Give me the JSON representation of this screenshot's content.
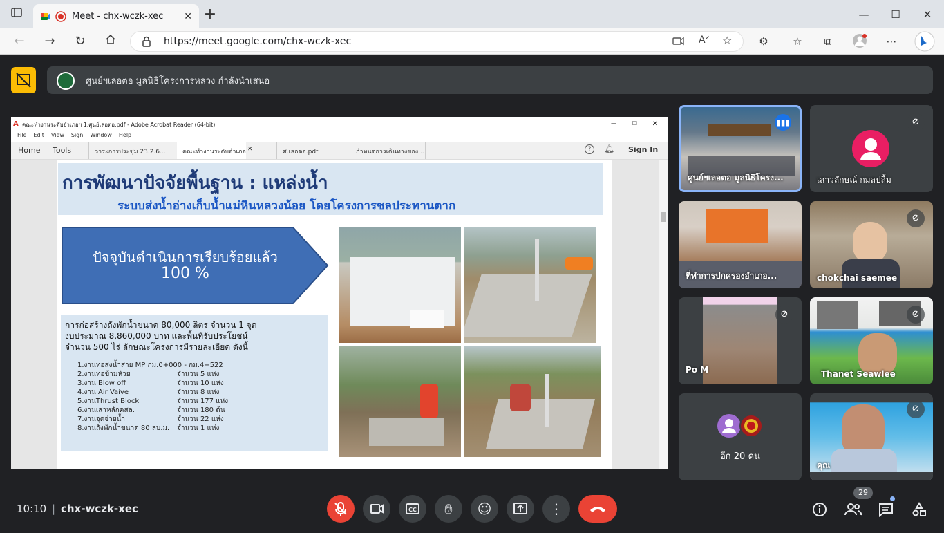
{
  "browser": {
    "tab_title": "Meet - chx-wczk-xec",
    "url": "https://meet.google.com/chx-wczk-xec"
  },
  "banner": {
    "text": "ศูนย์ฯเลอตอ มูลนิธิโครงการหลวง กำลังนำเสนอ"
  },
  "pdf_window": {
    "title": "คณะทำงานระดับอำเภอฯ 1.ศูนย์เลอตอ.pdf - Adobe Acrobat Reader (64-bit)",
    "menu": [
      "File",
      "Edit",
      "View",
      "Sign",
      "Window",
      "Help"
    ],
    "nav": [
      "Home",
      "Tools"
    ],
    "tabs": [
      "วาระการประชุม 23.2.6...",
      "คณะทำงานระดับอำเภอ...",
      "ศ.เลอตอ.pdf",
      "กำหนดการเดินทางของ..."
    ],
    "sign_in": "Sign In"
  },
  "slide": {
    "title": "การพัฒนาปัจจัยพื้นฐาน : แหล่งน้ำ",
    "subtitle": "ระบบส่งน้ำอ่างเก็บน้ำแม่หินหลวงน้อย  โดยโครงการชลประทานตาก",
    "arrow_line1": "ปัจจุบันดำเนินการเรียบร้อยแล้ว",
    "arrow_line2": "100 %",
    "para1": "การก่อสร้างถังพักน้ำขนาด 80,000 ลิตร จำนวน 1 จุด",
    "para2": "งบประมาณ 8,860,000 บาท และพื้นที่รับประโยชน์",
    "para3": "จำนวน 500 ไร่ ลักษณะโครงการมีรายละเอียด  ดังนี้",
    "items": [
      {
        "name": "1.งานท่อส่งน้ำสาย MP กม.0+000 - กม.4+522",
        "qty": ""
      },
      {
        "name": "2.งานท่อข้ามห้วย",
        "qty": "จำนวน  5      แห่ง"
      },
      {
        "name": "3.งาน Blow off",
        "qty": "จำนวน  10    แห่ง"
      },
      {
        "name": "4.งาน Air Vaive",
        "qty": "จำนวน  8      แห่ง"
      },
      {
        "name": "5.งานThrust Block",
        "qty": "จำนวน  177   แห่ง"
      },
      {
        "name": "6.งานเสาหลักคสล.",
        "qty": "จำนวน  180   ต้น"
      },
      {
        "name": "7.งานจุดจ่ายน้ำ",
        "qty": "จำนวน  22    แห่ง"
      },
      {
        "name": "8.งานถังพักน้ำขนาด 80 ลบ.ม.",
        "qty": "จำนวน  1      แห่ง"
      }
    ]
  },
  "participants": [
    {
      "name": "ศูนย์ฯเลอตอ มูลนิธิโครง...",
      "speaking": true
    },
    {
      "name": "เสาวลักษณ์ กมลปลื้ม",
      "muted": true
    },
    {
      "name": "ที่ทำการปกครองอำเภอ..."
    },
    {
      "name": "chokchai saemee",
      "muted": true
    },
    {
      "name": "Po M",
      "muted": true
    },
    {
      "name": "Thanet Seawlee",
      "muted": true
    },
    {
      "name": "อีก 20 คน"
    },
    {
      "name": "คุณ",
      "muted": true
    }
  ],
  "footer": {
    "time": "10:10",
    "meeting_code": "chx-wczk-xec",
    "participant_count": "29"
  },
  "colors": {
    "meet_bg": "#202124",
    "end_call": "#ea4335",
    "avatar_pink": "#e91e63",
    "slide_blue": "#3f6eb5"
  }
}
